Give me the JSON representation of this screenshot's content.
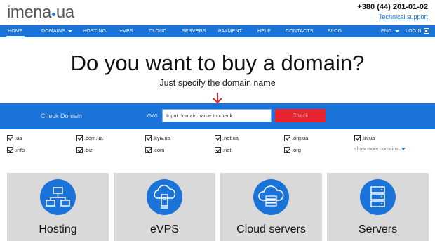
{
  "header": {
    "logo_left": "imena",
    "logo_right": "ua",
    "phone": "+380 (44) 201-01-02",
    "support_link": "Technical support"
  },
  "nav": {
    "items": [
      {
        "label": "HOME",
        "active": true
      },
      {
        "label": "DOMAINS"
      },
      {
        "label": "HOSTING"
      },
      {
        "label": "eVPS"
      },
      {
        "label": "CLOUD"
      },
      {
        "label": "SERVERS"
      },
      {
        "label": "PAYMENT"
      },
      {
        "label": "HELP"
      },
      {
        "label": "CONTACTS"
      },
      {
        "label": "BLOG"
      }
    ],
    "language": "ENG",
    "login": "LOGIN"
  },
  "hero": {
    "title": "Do you want to buy a domain?",
    "subtitle": "Just specify the domain name"
  },
  "check": {
    "label": "Check Domain",
    "www": "www.",
    "input_placeholder": "Input domain name to check",
    "button": "Check"
  },
  "zones": [
    {
      "label": ".ua",
      "checked": true
    },
    {
      "label": ".com.ua",
      "checked": true
    },
    {
      "label": ".kyiv.ua",
      "checked": true
    },
    {
      "label": ".net.ua",
      "checked": true
    },
    {
      "label": ".org.ua",
      "checked": true
    },
    {
      "label": ".in.ua",
      "checked": true
    },
    {
      "label": ".info",
      "checked": true
    },
    {
      "label": ".biz",
      "checked": true
    },
    {
      "label": ".com",
      "checked": true
    },
    {
      "label": ".net",
      "checked": true
    },
    {
      "label": ".org",
      "checked": true
    }
  ],
  "show_more": "show more domains",
  "services": [
    {
      "title": "Hosting",
      "icon": "network-diagram-icon"
    },
    {
      "title": "eVPS",
      "icon": "cloud-server-icon"
    },
    {
      "title": "Cloud servers",
      "icon": "cloud-rack-icon"
    },
    {
      "title": "Servers",
      "icon": "server-tower-icon"
    }
  ],
  "colors": {
    "brand_blue": "#1a73d9",
    "check_red": "#e8232e",
    "card_gray": "#d9d9d9"
  }
}
